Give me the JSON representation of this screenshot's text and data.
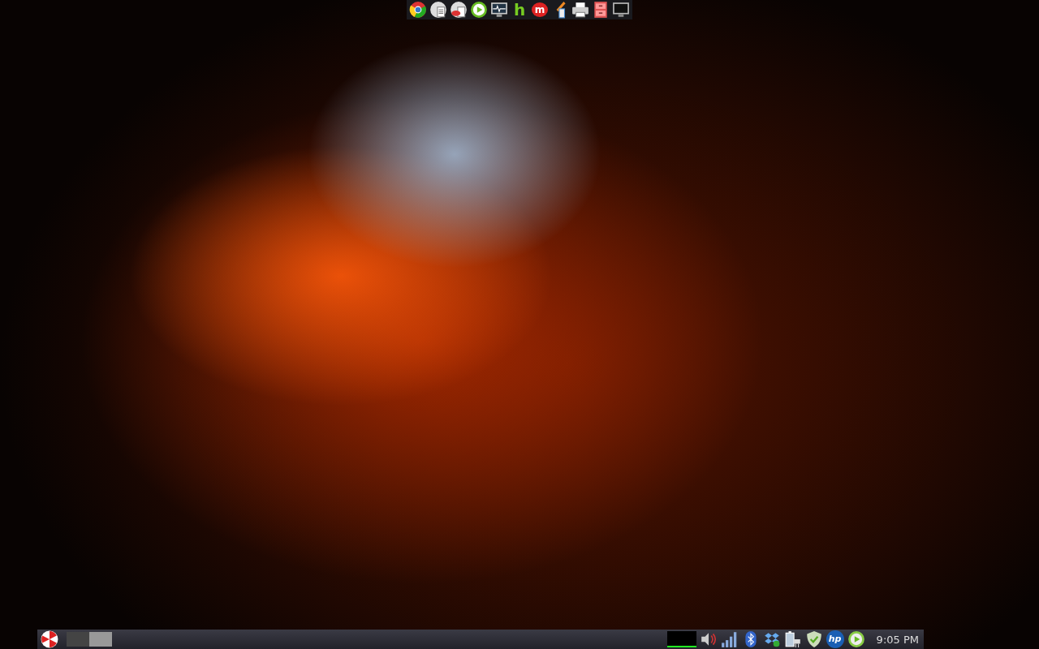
{
  "dock": {
    "items": [
      {
        "kind": "browser"
      },
      {
        "kind": "document"
      },
      {
        "kind": "document-alert"
      },
      {
        "kind": "play"
      },
      {
        "kind": "monitor-graph"
      },
      {
        "kind": "letter",
        "glyph": "h"
      },
      {
        "kind": "red-bubble",
        "glyph": "m"
      },
      {
        "kind": "paint"
      },
      {
        "kind": "printer"
      },
      {
        "kind": "cabinet"
      },
      {
        "kind": "display"
      }
    ]
  },
  "panel": {
    "workspaces": [
      {
        "selected": false
      },
      {
        "selected": true
      }
    ],
    "tray": [
      {
        "kind": "cpu-graph"
      },
      {
        "kind": "volume"
      },
      {
        "kind": "signal"
      },
      {
        "kind": "bluetooth"
      },
      {
        "kind": "dropbox"
      },
      {
        "kind": "battery"
      },
      {
        "kind": "shield"
      },
      {
        "kind": "hp",
        "glyph": "hp"
      },
      {
        "kind": "play"
      }
    ],
    "clock": "9:05 PM"
  }
}
